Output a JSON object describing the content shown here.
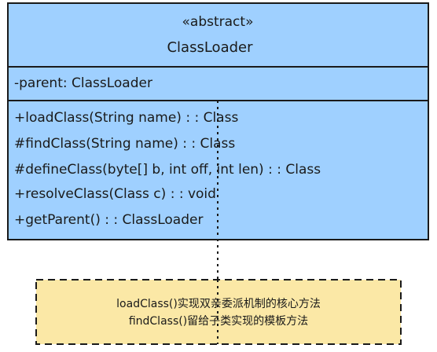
{
  "class_box": {
    "stereotype": "«abstract»",
    "name": "ClassLoader",
    "fill": "#9fd0ff",
    "border": "#1a1a1a",
    "attributes": [
      "-parent: ClassLoader"
    ],
    "methods": [
      "+loadClass(String name) : : Class",
      "#findClass(String name) : : Class",
      "#defineClass(byte[] b, int off, int len) : : Class",
      "+resolveClass(Class c) : : void",
      "+getParent() : : ClassLoader"
    ]
  },
  "note": {
    "fill": "#fbe8a6",
    "border": "#1a1a1a",
    "lines": [
      "loadClass()实现双亲委派机制的核心方法",
      "findClass()留给子类实现的模板方法"
    ]
  }
}
